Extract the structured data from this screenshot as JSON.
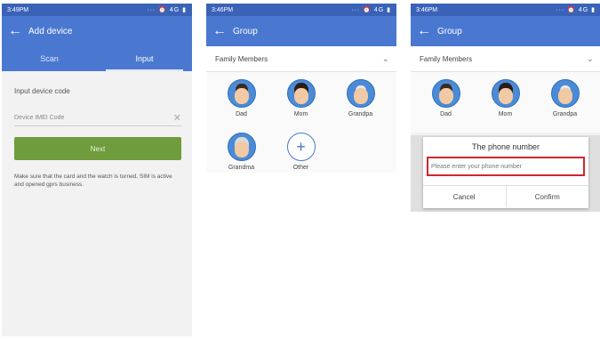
{
  "status_time_1": "3:49PM",
  "status_time_2": "3:46PM",
  "status_time_3": "3:46PM",
  "status_icons": "··· ⏰ 4G ▮",
  "screen1": {
    "title": "Add device",
    "tabs": [
      "Scan",
      "Input"
    ],
    "label": "Input device code",
    "placeholder": "Device IMEI Code",
    "next": "Next",
    "note": "Make sure that the card and the watch is turned, SIM is active and opened gprs business."
  },
  "screen2": {
    "title": "Group",
    "section": "Family Members",
    "members": [
      "Dad",
      "Mom",
      "Grandpa",
      "Grandma",
      "Other"
    ]
  },
  "screen3": {
    "title": "Group",
    "section": "Family Members",
    "members": [
      "Dad",
      "Mom",
      "Grandpa"
    ],
    "dialog": {
      "title": "The phone number",
      "placeholder": "Please enter your phone number",
      "cancel": "Cancel",
      "confirm": "Confirm"
    }
  }
}
